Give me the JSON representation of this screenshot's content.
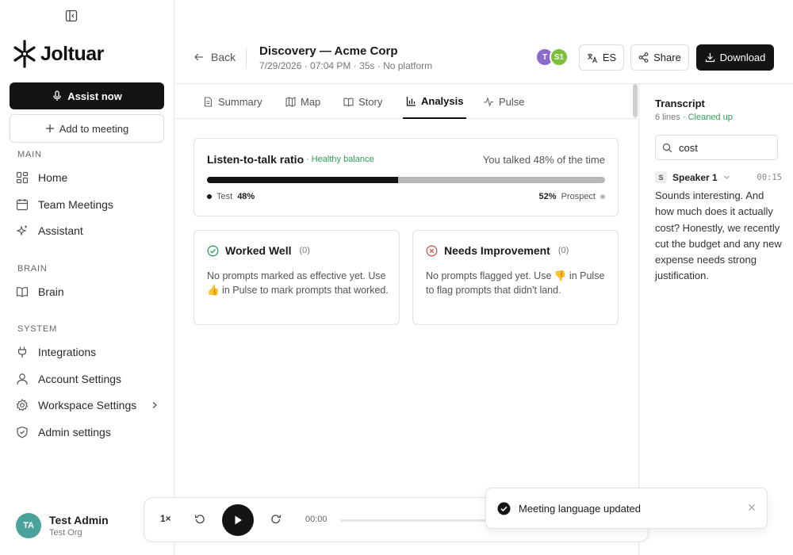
{
  "sidebar": {
    "logo_text": "Joltuar",
    "assist_label": "Assist now",
    "add_meeting_label": "Add to meeting",
    "sections": {
      "main": "MAIN",
      "brain": "BRAIN",
      "system": "SYSTEM"
    },
    "items": {
      "home": "Home",
      "team_meetings": "Team Meetings",
      "assistant": "Assistant",
      "brain": "Brain",
      "integrations": "Integrations",
      "account_settings": "Account Settings",
      "workspace_settings": "Workspace Settings",
      "admin_settings": "Admin settings"
    },
    "user": {
      "initials": "TA",
      "name": "Test Admin",
      "org": "Test Org"
    }
  },
  "header": {
    "back_label": "Back",
    "title": "Discovery — Acme Corp",
    "subtitle": "7/29/2026 · 07:04 PM · 35s · No platform",
    "participants": [
      {
        "initials": "T",
        "color": "#8a6bc9"
      },
      {
        "initials": "S1",
        "color": "#7dbf3a"
      }
    ],
    "language_label": "ES",
    "share_label": "Share",
    "download_label": "Download"
  },
  "tabs": {
    "summary": "Summary",
    "map": "Map",
    "story": "Story",
    "analysis": "Analysis",
    "pulse": "Pulse",
    "active": "analysis"
  },
  "analysis": {
    "ratio": {
      "title": "Listen-to-talk ratio",
      "badge": "· Healthy balance",
      "summary": "You talked 48% of the time",
      "talk_fraction": 0.48,
      "left_name": "Test",
      "left_pct": "48%",
      "right_name": "Prospect",
      "right_pct": "52%"
    },
    "worked_well": {
      "title": "Worked Well",
      "count": "(0)",
      "body": "No prompts marked as effective yet. Use 👍 in Pulse to mark prompts that worked."
    },
    "needs_improvement": {
      "title": "Needs Improvement",
      "count": "(0)",
      "body": "No prompts flagged yet. Use 👎 in Pulse to flag prompts that didn't land."
    }
  },
  "transcript": {
    "title": "Transcript",
    "lines": "6 lines",
    "status": "· Cleaned up",
    "search_value": "cost",
    "entry": {
      "speaker_initial": "S",
      "speaker": "Speaker 1",
      "time": "00:15",
      "text": "Sounds interesting. And how much does it actually cost? Honestly, we recently cut the budget and any new expense needs strong justification."
    }
  },
  "player": {
    "speed": "1×",
    "current_time": "00:00"
  },
  "toast": {
    "message": "Meeting language updated"
  }
}
